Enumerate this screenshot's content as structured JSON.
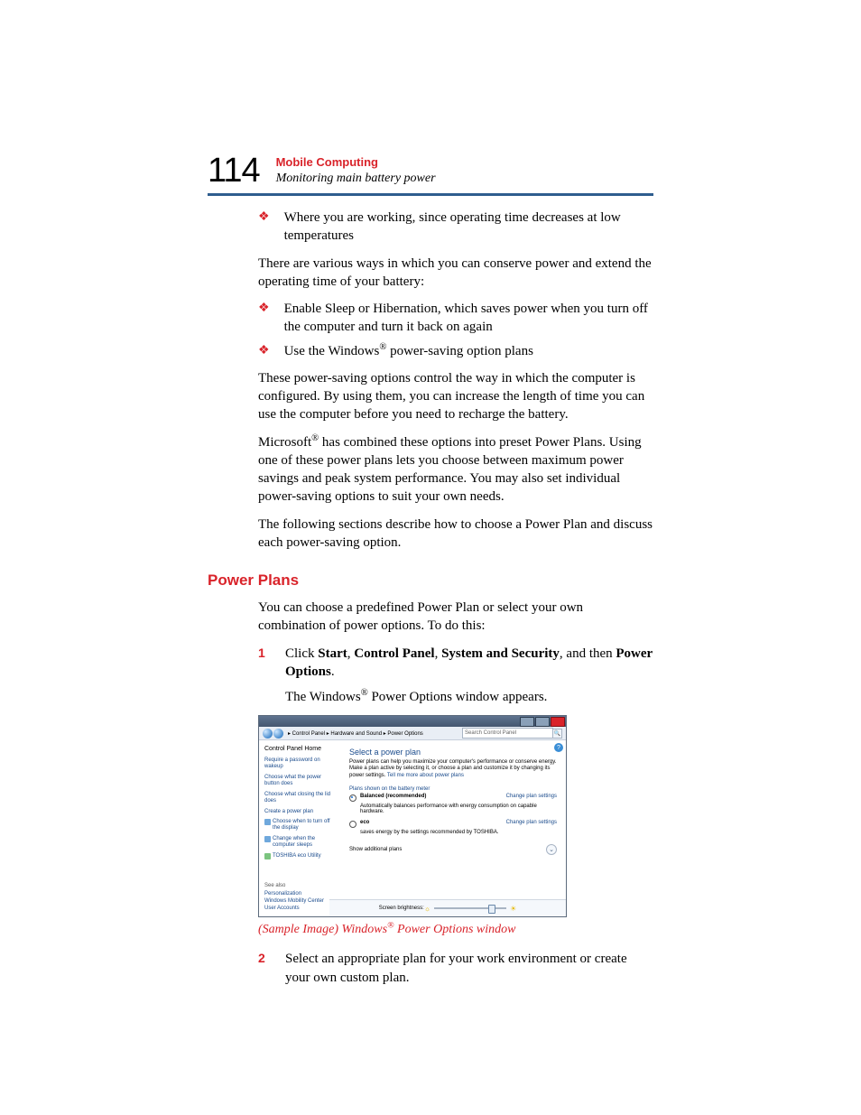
{
  "page_number": "114",
  "chapter_title": "Mobile Computing",
  "section_title": "Monitoring main battery power",
  "intro_bullets": [
    "Where you are working, since operating time decreases at low temperatures"
  ],
  "para_various": "There are various ways in which you can conserve power and extend the operating time of your battery:",
  "conserve_bullets": [
    "Enable Sleep or Hibernation, which saves power when you turn off the computer and turn it back on again",
    "Use the Windows® power-saving option plans"
  ],
  "para_control": "These power-saving options control the way in which the computer is configured. By using them, you can increase the length of time you can use the computer before you need to recharge the battery.",
  "para_microsoft": "Microsoft® has combined these options into preset Power Plans. Using one of these power plans lets you choose between maximum power savings and peak system performance. You may also set individual power-saving options to suit your own needs.",
  "para_following": "The following sections describe how to choose a Power Plan and discuss each power-saving option.",
  "subheading": "Power Plans",
  "para_choose": "You can choose a predefined Power Plan or select your own combination of power options. To do this:",
  "steps": {
    "s1_num": "1",
    "s1_text": "Click Start, Control Panel, System and Security, and then Power Options.",
    "s1_sub": "The Windows® Power Options window appears.",
    "s2_num": "2",
    "s2_text": "Select an appropriate plan for your work environment or create your own custom plan."
  },
  "caption": "(Sample Image) Windows® Power Options window",
  "screenshot": {
    "breadcrumb": "▸ Control Panel ▸ Hardware and Sound ▸ Power Options",
    "search_placeholder": "Search Control Panel",
    "help": "?",
    "sidebar": {
      "home": "Control Panel Home",
      "l1": "Require a password on wakeup",
      "l2": "Choose what the power button does",
      "l3": "Choose what closing the lid does",
      "l4": "Create a power plan",
      "l5": "Choose when to turn off the display",
      "l6": "Change when the computer sleeps",
      "l7": "TOSHIBA eco Utility",
      "see_also": "See also",
      "b1": "Personalization",
      "b2": "Windows Mobility Center",
      "b3": "User Accounts"
    },
    "main": {
      "title": "Select a power plan",
      "desc_a": "Power plans can help you maximize your computer's performance or conserve energy. Make a plan active by selecting it, or choose a plan and customize it by changing its power settings. ",
      "desc_link": "Tell me more about power plans",
      "shown": "Plans shown on the battery meter",
      "plan1_name": "Balanced (recommended)",
      "plan1_change": "Change plan settings",
      "plan1_desc": "Automatically balances performance with energy consumption on capable hardware.",
      "plan2_name": "eco",
      "plan2_change": "Change plan settings",
      "plan2_desc": "saves energy by the settings recommended by TOSHIBA.",
      "show_additional": "Show additional plans",
      "expand": "⌄",
      "brightness_label": "Screen brightness:"
    }
  }
}
